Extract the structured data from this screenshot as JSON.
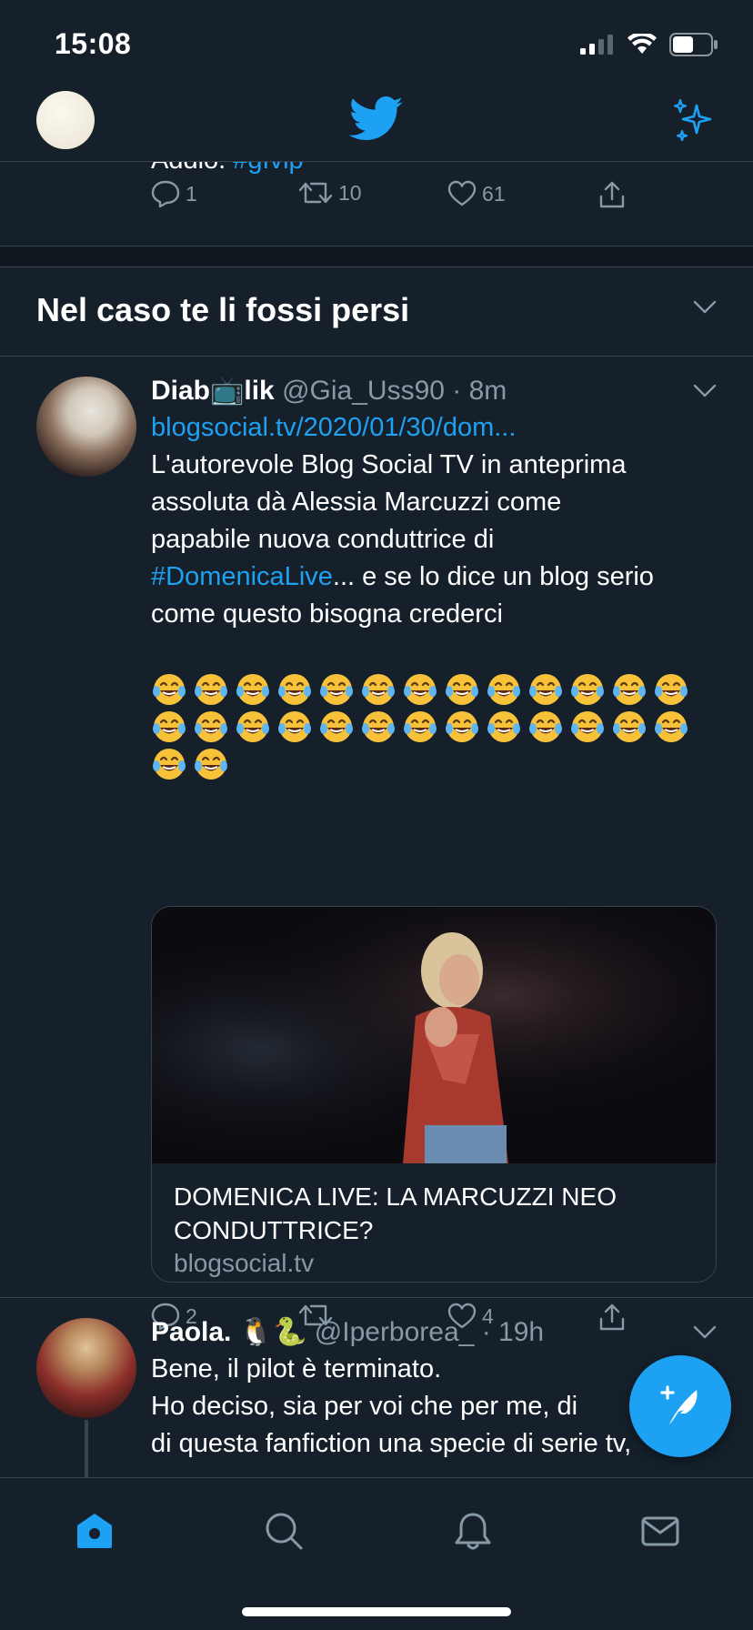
{
  "status_bar": {
    "time": "15:08"
  },
  "top_bar": {
    "logo_icon": "twitter-bird-icon",
    "sparkle_icon": "sparkle-icon"
  },
  "previous_tweet": {
    "text_tail": "Addio. ",
    "hashtag": "#gfvip",
    "replies": "1",
    "retweets": "10",
    "likes": "61"
  },
  "section": {
    "title": "Nel caso te li fossi persi"
  },
  "tweets": [
    {
      "name_part1": "Diab",
      "name_emoji": "📺",
      "name_part2": "lik",
      "handle": "@Gia_Uss90",
      "sep": "·",
      "time": "8m",
      "link": "blogsocial.tv/2020/01/30/dom...",
      "line1": "L'autorevole Blog Social TV in anteprima",
      "line2": "assoluta dà Alessia Marcuzzi come",
      "line3": "papabile nuova conduttrice di",
      "hashtag": "#DomenicaLive",
      "line4_rest": "... e se lo dice un blog serio",
      "line5": "come questo bisogna crederci",
      "laugh_emoji_count": 28,
      "card": {
        "title": "DOMENICA LIVE: LA MARCUZZI NEO CONDUTTRICE?",
        "domain": "blogsocial.tv"
      },
      "replies": "2",
      "retweets": "",
      "likes": "4"
    },
    {
      "name": "Paola.",
      "name_emojis": "🐧🐍",
      "handle": "@Iperborea_",
      "sep": "·",
      "time": "19h",
      "line1": "Bene, il pilot è terminato.",
      "line2": "Ho deciso, sia per voi che per me, di",
      "line3": "di questa fanfiction una specie di serie tv,"
    }
  ],
  "tab_bar": {
    "tabs": [
      {
        "icon": "home-icon",
        "active": true
      },
      {
        "icon": "search-icon",
        "active": false
      },
      {
        "icon": "bell-icon",
        "active": false
      },
      {
        "icon": "mail-icon",
        "active": false
      }
    ]
  },
  "colors": {
    "background": "#15202b",
    "accent": "#1da1f2",
    "muted": "#8899a6",
    "border": "#38444d"
  }
}
